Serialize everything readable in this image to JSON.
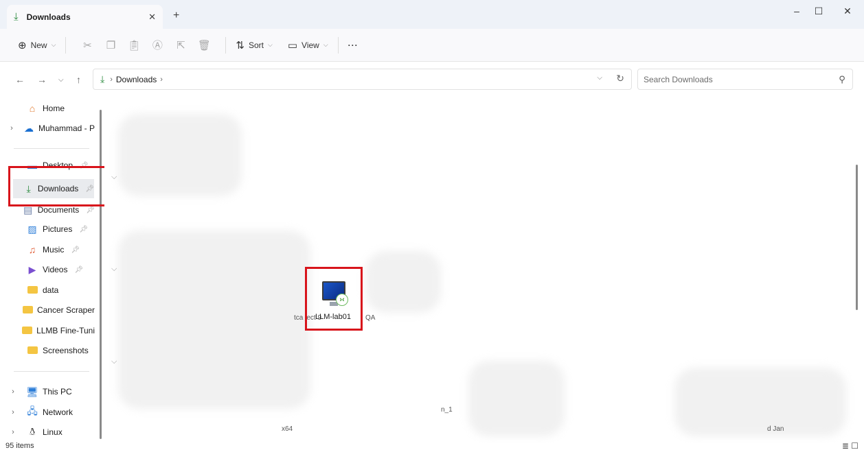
{
  "tab": {
    "title": "Downloads",
    "icon": "download-icon",
    "close": "✕",
    "new_tab": "+"
  },
  "window_controls": {
    "minimize": "–",
    "maximize": "☐",
    "close": "✕"
  },
  "toolbar": {
    "new_label": "New",
    "sort_label": "Sort",
    "view_label": "View",
    "more_label": "···",
    "icons": [
      "cut-icon",
      "copy-icon",
      "paste-icon",
      "rename-icon",
      "share-icon",
      "delete-icon"
    ]
  },
  "address": {
    "crumbs": [
      "Downloads"
    ],
    "separator": "›"
  },
  "search": {
    "placeholder": "Search Downloads"
  },
  "sidebar": {
    "items": [
      {
        "label": "Home",
        "icon": "home-icon"
      },
      {
        "label": "Muhammad - P",
        "icon": "onedrive-icon",
        "expandable": true
      },
      {
        "label": "Desktop",
        "icon": "desktop-icon",
        "pinned": true
      },
      {
        "label": "Downloads",
        "icon": "download-icon",
        "pinned": true,
        "selected": true
      },
      {
        "label": "Documents",
        "icon": "documents-icon",
        "pinned": true
      },
      {
        "label": "Pictures",
        "icon": "pictures-icon",
        "pinned": true
      },
      {
        "label": "Music",
        "icon": "music-icon",
        "pinned": true
      },
      {
        "label": "Videos",
        "icon": "videos-icon",
        "pinned": true
      },
      {
        "label": "data",
        "icon": "folder-icon"
      },
      {
        "label": "Cancer Scraper",
        "icon": "folder-icon"
      },
      {
        "label": "LLMB Fine-Tuni",
        "icon": "folder-icon"
      },
      {
        "label": "Screenshots",
        "icon": "folder-icon"
      },
      {
        "label": "This PC",
        "icon": "pc-icon",
        "expandable": true
      },
      {
        "label": "Network",
        "icon": "network-icon",
        "expandable": true
      },
      {
        "label": "Linux",
        "icon": "linux-icon",
        "expandable": true
      }
    ]
  },
  "content": {
    "highlighted_file": {
      "name": "LLM-lab01",
      "icon": "remote-desktop-icon"
    },
    "fragments": {
      "left": "tca ject 9",
      "right": "QA",
      "bottom_mid": "n_1",
      "bottom_left": "x64",
      "bottom_right": "d Jan"
    }
  },
  "status": {
    "item_count": "95 items"
  },
  "colors": {
    "highlight": "#d8141b",
    "accent_green": "#2b8a3e",
    "titlebar_bg": "#eef2f8"
  }
}
